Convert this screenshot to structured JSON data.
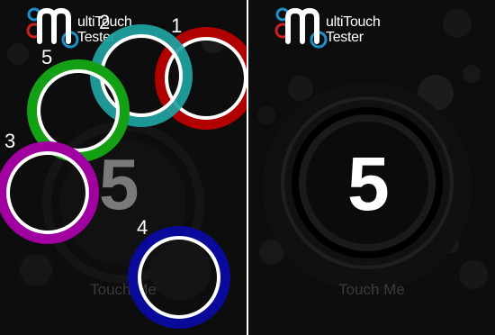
{
  "app": {
    "logo_line1": "ultiTouch",
    "logo_line2": "Tester",
    "touch_label": "Touch Me"
  },
  "left_panel": {
    "touch_count": "5",
    "touches": [
      {
        "id": "1",
        "color": "#b00000"
      },
      {
        "id": "2",
        "color": "#1fa3a3"
      },
      {
        "id": "3",
        "color": "#a000a0"
      },
      {
        "id": "4",
        "color": "#0a0a9a"
      },
      {
        "id": "5",
        "color": "#14a014"
      }
    ]
  },
  "right_panel": {
    "touch_count": "5"
  },
  "colors": {
    "background": "#0d0d0d",
    "ring": "#ffffff",
    "logo_blue": "#1e90c8",
    "logo_red": "#d02020"
  }
}
